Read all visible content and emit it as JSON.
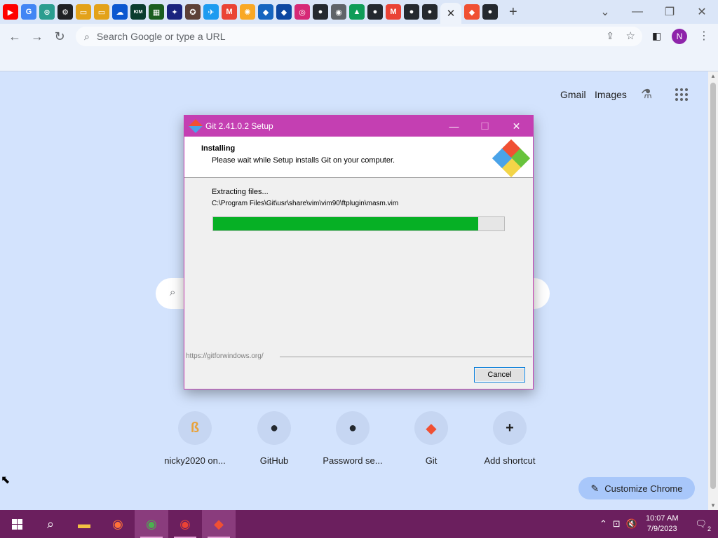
{
  "browser": {
    "tabs_favicons": [
      {
        "name": "youtube-icon",
        "glyph": "▶",
        "color": "#ff0000"
      },
      {
        "name": "google-icon",
        "glyph": "G",
        "color": "#4285f4"
      },
      {
        "name": "clock-icon",
        "glyph": "⊙",
        "color": "#2a9d8f"
      },
      {
        "name": "gear-icon",
        "glyph": "⚙",
        "color": "#202124"
      },
      {
        "name": "folder-icon",
        "glyph": "▭",
        "color": "#e3a21a"
      },
      {
        "name": "folder-icon",
        "glyph": "▭",
        "color": "#e3a21a"
      },
      {
        "name": "cloud-icon",
        "glyph": "☁",
        "color": "#0b57d0"
      },
      {
        "name": "kim-icon",
        "glyph": "KIM",
        "color": "#0a3d2e"
      },
      {
        "name": "game-icon",
        "glyph": "▦",
        "color": "#1b5e20"
      },
      {
        "name": "puzzle-icon",
        "glyph": "✦",
        "color": "#1a237e"
      },
      {
        "name": "badge-icon",
        "glyph": "✪",
        "color": "#5d4037"
      },
      {
        "name": "twitter-icon",
        "glyph": "✈",
        "color": "#1d9bf0"
      },
      {
        "name": "gmail-icon",
        "glyph": "M",
        "color": "#ea4335"
      },
      {
        "name": "lightbulb-icon",
        "glyph": "✺",
        "color": "#f9a825"
      },
      {
        "name": "sonic-icon",
        "glyph": "◆",
        "color": "#1565c0"
      },
      {
        "name": "sonic-icon",
        "glyph": "◆",
        "color": "#0d47a1"
      },
      {
        "name": "instagram-icon",
        "glyph": "◎",
        "color": "#d62976"
      },
      {
        "name": "github-icon",
        "glyph": "●",
        "color": "#24292f"
      },
      {
        "name": "chrome-icon",
        "glyph": "◉",
        "color": "#5f6368"
      },
      {
        "name": "drive-icon",
        "glyph": "▲",
        "color": "#0f9d58"
      },
      {
        "name": "github-icon",
        "glyph": "●",
        "color": "#24292f"
      },
      {
        "name": "gmail-icon",
        "glyph": "M",
        "color": "#ea4335"
      },
      {
        "name": "github-icon",
        "glyph": "●",
        "color": "#24292f"
      },
      {
        "name": "github-icon",
        "glyph": "●",
        "color": "#24292f"
      }
    ],
    "active_tab_close": "✕",
    "after_tabs": [
      {
        "name": "git-icon",
        "glyph": "◆",
        "color": "#f05033"
      },
      {
        "name": "github-icon",
        "glyph": "●",
        "color": "#24292f"
      }
    ],
    "new_tab_glyph": "+",
    "omnibox_placeholder": "Search Google or type a URL",
    "profile_initial": "N"
  },
  "ntp": {
    "gmail": "Gmail",
    "images": "Images",
    "shortcuts": [
      {
        "label": "nicky2020 on...",
        "glyph": "ß",
        "color": "#e8a33d"
      },
      {
        "label": "GitHub",
        "glyph": "●",
        "color": "#24292f"
      },
      {
        "label": "Password se...",
        "glyph": "●",
        "color": "#24292f"
      },
      {
        "label": "Git",
        "glyph": "◆",
        "color": "#f05033"
      },
      {
        "label": "Add shortcut",
        "glyph": "+",
        "color": "#1f1f1f"
      }
    ],
    "customize_label": "Customize Chrome"
  },
  "dialog": {
    "title": "Git 2.41.0.2 Setup",
    "heading": "Installing",
    "subheading": "Please wait while Setup installs Git on your computer.",
    "status": "Extracting files...",
    "file_path": "C:\\Program Files\\Git\\usr\\share\\vim\\vim90\\ftplugin\\masm.vim",
    "progress_fraction": 0.91,
    "footer_url": "https://gitforwindows.org/",
    "cancel_label": "Cancel",
    "accent_color": "#c43fb2",
    "progress_color": "#06b025"
  },
  "taskbar": {
    "clock_time": "10:07 AM",
    "clock_date": "7/9/2023",
    "notifications_count": "2"
  }
}
